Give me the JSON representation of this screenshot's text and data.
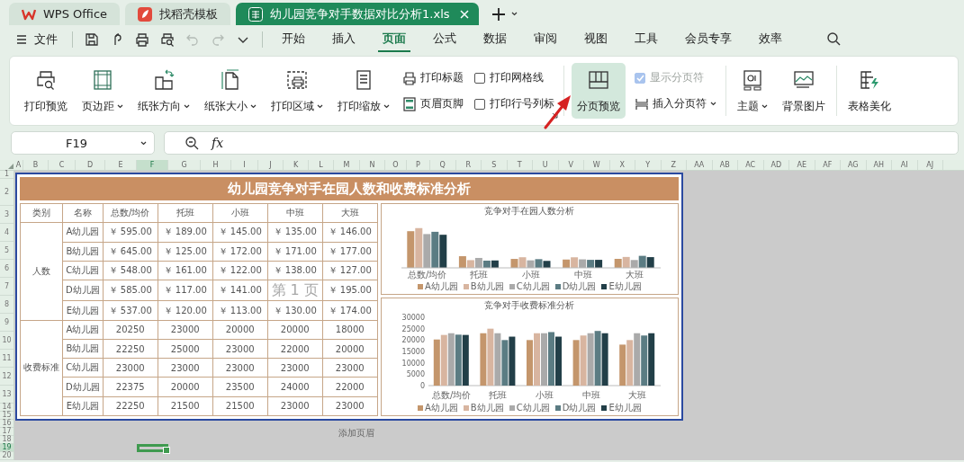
{
  "title_tabs": [
    {
      "kind": "home",
      "label": "WPS Office",
      "selected": false
    },
    {
      "kind": "template",
      "label": "找稻壳模板",
      "selected": false
    },
    {
      "kind": "sheet",
      "label": "幼儿园竞争对手数据对比分析1.xls",
      "selected": true
    }
  ],
  "menu_bar": {
    "file_label": "文件",
    "quick_tools": [
      {
        "kind": "save",
        "disabled": false
      },
      {
        "kind": "share",
        "disabled": false
      },
      {
        "kind": "print",
        "disabled": false
      },
      {
        "kind": "preview",
        "disabled": false
      },
      {
        "kind": "undo",
        "disabled": true
      },
      {
        "kind": "redo",
        "disabled": true
      },
      {
        "kind": "more",
        "disabled": false
      }
    ],
    "tabs": [
      {
        "label": "开始",
        "selected": false
      },
      {
        "label": "插入",
        "selected": false
      },
      {
        "label": "页面",
        "selected": true
      },
      {
        "label": "公式",
        "selected": false
      },
      {
        "label": "数据",
        "selected": false
      },
      {
        "label": "审阅",
        "selected": false
      },
      {
        "label": "视图",
        "selected": false
      },
      {
        "label": "工具",
        "selected": false
      },
      {
        "label": "会员专享",
        "selected": false
      },
      {
        "label": "效率",
        "selected": false
      }
    ]
  },
  "ribbon": {
    "groups": [
      [
        {
          "kind": "big",
          "label": "打印预览",
          "dropdown": false,
          "on": false
        },
        {
          "kind": "big",
          "label": "页边距",
          "dropdown": true,
          "on": false
        },
        {
          "kind": "big",
          "label": "纸张方向",
          "dropdown": true,
          "on": false
        },
        {
          "kind": "big",
          "label": "纸张大小",
          "dropdown": true,
          "on": false
        },
        {
          "kind": "big",
          "label": "打印区域",
          "dropdown": true,
          "on": false
        },
        {
          "kind": "big",
          "label": "打印缩放",
          "dropdown": true,
          "on": false
        },
        {
          "kind": "stack",
          "rows": [
            {
              "kind": "small",
              "label": "打印标题",
              "dropdown": false
            },
            {
              "kind": "small",
              "label": "页眉页脚",
              "dropdown": false
            }
          ]
        },
        {
          "kind": "stack",
          "rows": [
            {
              "kind": "check",
              "label": "打印网格线",
              "checked": false,
              "disabled": false
            },
            {
              "kind": "check",
              "label": "打印行号列标",
              "checked": false,
              "disabled": false
            }
          ]
        }
      ],
      [
        {
          "kind": "big",
          "label": "分页预览",
          "dropdown": false,
          "on": true
        },
        {
          "kind": "stack",
          "rows": [
            {
              "kind": "check",
              "label": "显示分页符",
              "checked": true,
              "disabled": true
            },
            {
              "kind": "small",
              "label": "插入分页符",
              "dropdown": true
            }
          ]
        }
      ],
      [
        {
          "kind": "big",
          "label": "主题",
          "dropdown": true,
          "on": false
        },
        {
          "kind": "big",
          "label": "背景图片",
          "dropdown": false,
          "on": false
        }
      ],
      [
        {
          "kind": "big",
          "label": "表格美化",
          "dropdown": false,
          "on": false
        }
      ]
    ]
  },
  "formula_bar": {
    "name_box": "F19",
    "function_label": "fx"
  },
  "sheet": {
    "columns": [
      {
        "label": "A",
        "selected": false
      },
      {
        "label": "B",
        "selected": false
      },
      {
        "label": "C",
        "selected": false
      },
      {
        "label": "D",
        "selected": false
      },
      {
        "label": "E",
        "selected": false
      },
      {
        "label": "F",
        "selected": true
      },
      {
        "label": "G",
        "selected": false
      },
      {
        "label": "H",
        "selected": false
      },
      {
        "label": "I",
        "selected": false
      },
      {
        "label": "J",
        "selected": false
      },
      {
        "label": "K",
        "selected": false
      },
      {
        "label": "L",
        "selected": false
      },
      {
        "label": "M",
        "selected": false
      },
      {
        "label": "N",
        "selected": false
      },
      {
        "label": "O",
        "selected": false
      },
      {
        "label": "P",
        "selected": false
      },
      {
        "label": "Q",
        "selected": false
      },
      {
        "label": "R",
        "selected": false
      },
      {
        "label": "S",
        "selected": false
      },
      {
        "label": "T",
        "selected": false
      },
      {
        "label": "U",
        "selected": false
      },
      {
        "label": "V",
        "selected": false
      },
      {
        "label": "W",
        "selected": false
      },
      {
        "label": "X",
        "selected": false
      },
      {
        "label": "Y",
        "selected": false
      },
      {
        "label": "Z",
        "selected": false
      },
      {
        "label": "AA",
        "selected": false
      },
      {
        "label": "AB",
        "selected": false
      },
      {
        "label": "AC",
        "selected": false
      },
      {
        "label": "AD",
        "selected": false
      },
      {
        "label": "AE",
        "selected": false
      },
      {
        "label": "AF",
        "selected": false
      },
      {
        "label": "AG",
        "selected": false
      },
      {
        "label": "AH",
        "selected": false
      },
      {
        "label": "AI",
        "selected": false
      },
      {
        "label": "AJ",
        "selected": false
      }
    ],
    "rows": [
      {
        "label": "1",
        "selected": false
      },
      {
        "label": "2",
        "selected": false
      },
      {
        "label": "3",
        "selected": false
      },
      {
        "label": "4",
        "selected": false
      },
      {
        "label": "5",
        "selected": false
      },
      {
        "label": "6",
        "selected": false
      },
      {
        "label": "7",
        "selected": false
      },
      {
        "label": "8",
        "selected": false
      },
      {
        "label": "9",
        "selected": false
      },
      {
        "label": "10",
        "selected": false
      },
      {
        "label": "11",
        "selected": false
      },
      {
        "label": "12",
        "selected": false
      },
      {
        "label": "13",
        "selected": false
      },
      {
        "label": "14",
        "selected": false
      },
      {
        "label": "15",
        "selected": false
      },
      {
        "label": "16",
        "selected": false
      },
      {
        "label": "17",
        "selected": false
      },
      {
        "label": "18",
        "selected": false
      },
      {
        "label": "19",
        "selected": true
      },
      {
        "label": "20",
        "selected": false
      }
    ],
    "page": {
      "title": "幼儿园竞争对手在园人数和收费标准分析",
      "table": {
        "columns": [
          "类别",
          "名称",
          "总数/均价",
          "托班",
          "小班",
          "中班",
          "大班"
        ],
        "groups": [
          {
            "label": "人数",
            "rows": [
              {
                "name": "A幼儿园",
                "cells": [
                  "￥ 595.00",
                  "￥ 189.00",
                  "￥ 145.00",
                  "￥ 135.00",
                  "￥ 146.00"
                ]
              },
              {
                "name": "B幼儿园",
                "cells": [
                  "￥ 645.00",
                  "￥ 125.00",
                  "￥ 172.00",
                  "￥ 171.00",
                  "￥ 177.00"
                ]
              },
              {
                "name": "C幼儿园",
                "cells": [
                  "￥ 548.00",
                  "￥ 161.00",
                  "￥ 122.00",
                  "￥ 138.00",
                  "￥ 127.00"
                ]
              },
              {
                "name": "D幼儿园",
                "cells": [
                  "￥ 585.00",
                  "￥ 117.00",
                  "￥ 141.00",
                  null,
                  "￥ 195.00"
                ]
              },
              {
                "name": "E幼儿园",
                "cells": [
                  "￥ 537.00",
                  "￥ 120.00",
                  "￥ 113.00",
                  "￥ 130.00",
                  "￥ 174.00"
                ]
              }
            ]
          },
          {
            "label": "收费标准",
            "rows": [
              {
                "name": "A幼儿园",
                "cells": [
                  "20250",
                  "23000",
                  "20000",
                  "20000",
                  "18000"
                ]
              },
              {
                "name": "B幼儿园",
                "cells": [
                  "22250",
                  "25000",
                  "23000",
                  "22000",
                  "20000"
                ]
              },
              {
                "name": "C幼儿园",
                "cells": [
                  "23000",
                  "23000",
                  "23000",
                  "23000",
                  "23000"
                ]
              },
              {
                "name": "D幼儿园",
                "cells": [
                  "22375",
                  "20000",
                  "23500",
                  "24000",
                  "22000"
                ]
              },
              {
                "name": "E幼儿园",
                "cells": [
                  "22250",
                  "21500",
                  "21500",
                  "23000",
                  "23000"
                ]
              }
            ]
          }
        ]
      },
      "page_label": "第 1 页",
      "charts": [
        {
          "title": "竞争对手在园人数分析",
          "categories": [
            "总数/均价",
            "托班",
            "小班",
            "中班",
            "大班"
          ],
          "legend": [
            {
              "label": "A幼儿园",
              "color": "#c4966c"
            },
            {
              "label": "B幼儿园",
              "color": "#d8b5a0"
            },
            {
              "label": "C幼儿园",
              "color": "#aaaaaa"
            },
            {
              "label": "D幼儿园",
              "color": "#5b7c83"
            },
            {
              "label": "E幼儿园",
              "color": "#223f48"
            }
          ]
        },
        {
          "chart_data": {
            "type": "bar",
            "title": "竞争对手收费标准分析",
            "categories": [
              "总数/均价",
              "托班",
              "小班",
              "中班",
              "大班"
            ],
            "series": [
              {
                "name": "A幼儿园",
                "color": "#c4966c",
                "values": [
                  20250,
                  23000,
                  20000,
                  20000,
                  18000
                ]
              },
              {
                "name": "B幼儿园",
                "color": "#d8b5a0",
                "values": [
                  22250,
                  25000,
                  23000,
                  22000,
                  20000
                ]
              },
              {
                "name": "C幼儿园",
                "color": "#aaaaaa",
                "values": [
                  23000,
                  23000,
                  23000,
                  23000,
                  23000
                ]
              },
              {
                "name": "D幼儿园",
                "color": "#5b7c83",
                "values": [
                  22375,
                  20000,
                  23500,
                  24000,
                  22000
                ]
              },
              {
                "name": "E幼儿园",
                "color": "#223f48",
                "values": [
                  22250,
                  21500,
                  21500,
                  23000,
                  23000
                ]
              }
            ],
            "legend": true,
            "ylim": [
              0,
              30000
            ],
            "yticks": [
              0,
              5000,
              10000,
              15000,
              20000,
              25000,
              30000
            ]
          }
        }
      ]
    },
    "header_hint": "添加页眉"
  }
}
